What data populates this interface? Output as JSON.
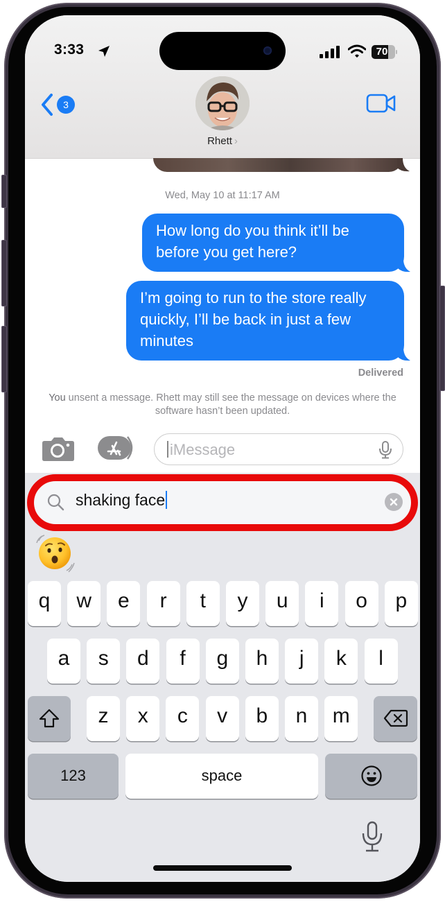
{
  "status_bar": {
    "time": "3:33",
    "location_icon": "location-arrow-icon",
    "signal_icon": "cellular-signal-icon",
    "wifi_icon": "wifi-icon",
    "battery_level": "70",
    "battery_percent": 70
  },
  "header": {
    "back_badge_count": "3",
    "back_icon": "chevron-left-icon",
    "contact_name": "Rhett",
    "contact_chevron": "›",
    "video_icon": "video-camera-icon"
  },
  "conversation": {
    "timestamp": "Wed, May 10 at 11:17 AM",
    "messages": [
      {
        "sender": "me",
        "text": "How long do you think it’ll be before you get here?"
      },
      {
        "sender": "me",
        "text": "I’m going to run to the store really quickly, I’ll be back in just a few minutes"
      }
    ],
    "delivery_status": "Delivered",
    "unsent_notice_you": "You",
    "unsent_notice_rest": " unsent a message. Rhett may still see the message on devices where the software hasn’t been updated."
  },
  "composer": {
    "camera_icon": "camera-icon",
    "apps_icon": "app-store-icon",
    "placeholder": "iMessage",
    "mic_icon": "microphone-icon"
  },
  "emoji_search": {
    "query": "shaking face",
    "results": [
      {
        "name": "shaking face",
        "glyph": "🫨"
      }
    ],
    "clear_icon": "clear-x-icon"
  },
  "keyboard": {
    "row1": [
      "q",
      "w",
      "e",
      "r",
      "t",
      "y",
      "u",
      "i",
      "o",
      "p"
    ],
    "row2": [
      "a",
      "s",
      "d",
      "f",
      "g",
      "h",
      "j",
      "k",
      "l"
    ],
    "row3": [
      "z",
      "x",
      "c",
      "v",
      "b",
      "n",
      "m"
    ],
    "shift_icon": "shift-icon",
    "delete_icon": "delete-backspace-icon",
    "numbers_label": "123",
    "space_label": "space",
    "emoji_icon": "emoji-smiley-icon",
    "dictation_icon": "microphone-icon"
  },
  "colors": {
    "imessage_blue": "#1a7cf5",
    "highlight_red": "#e80a0a",
    "keyboard_bg": "#e6e7eb"
  }
}
